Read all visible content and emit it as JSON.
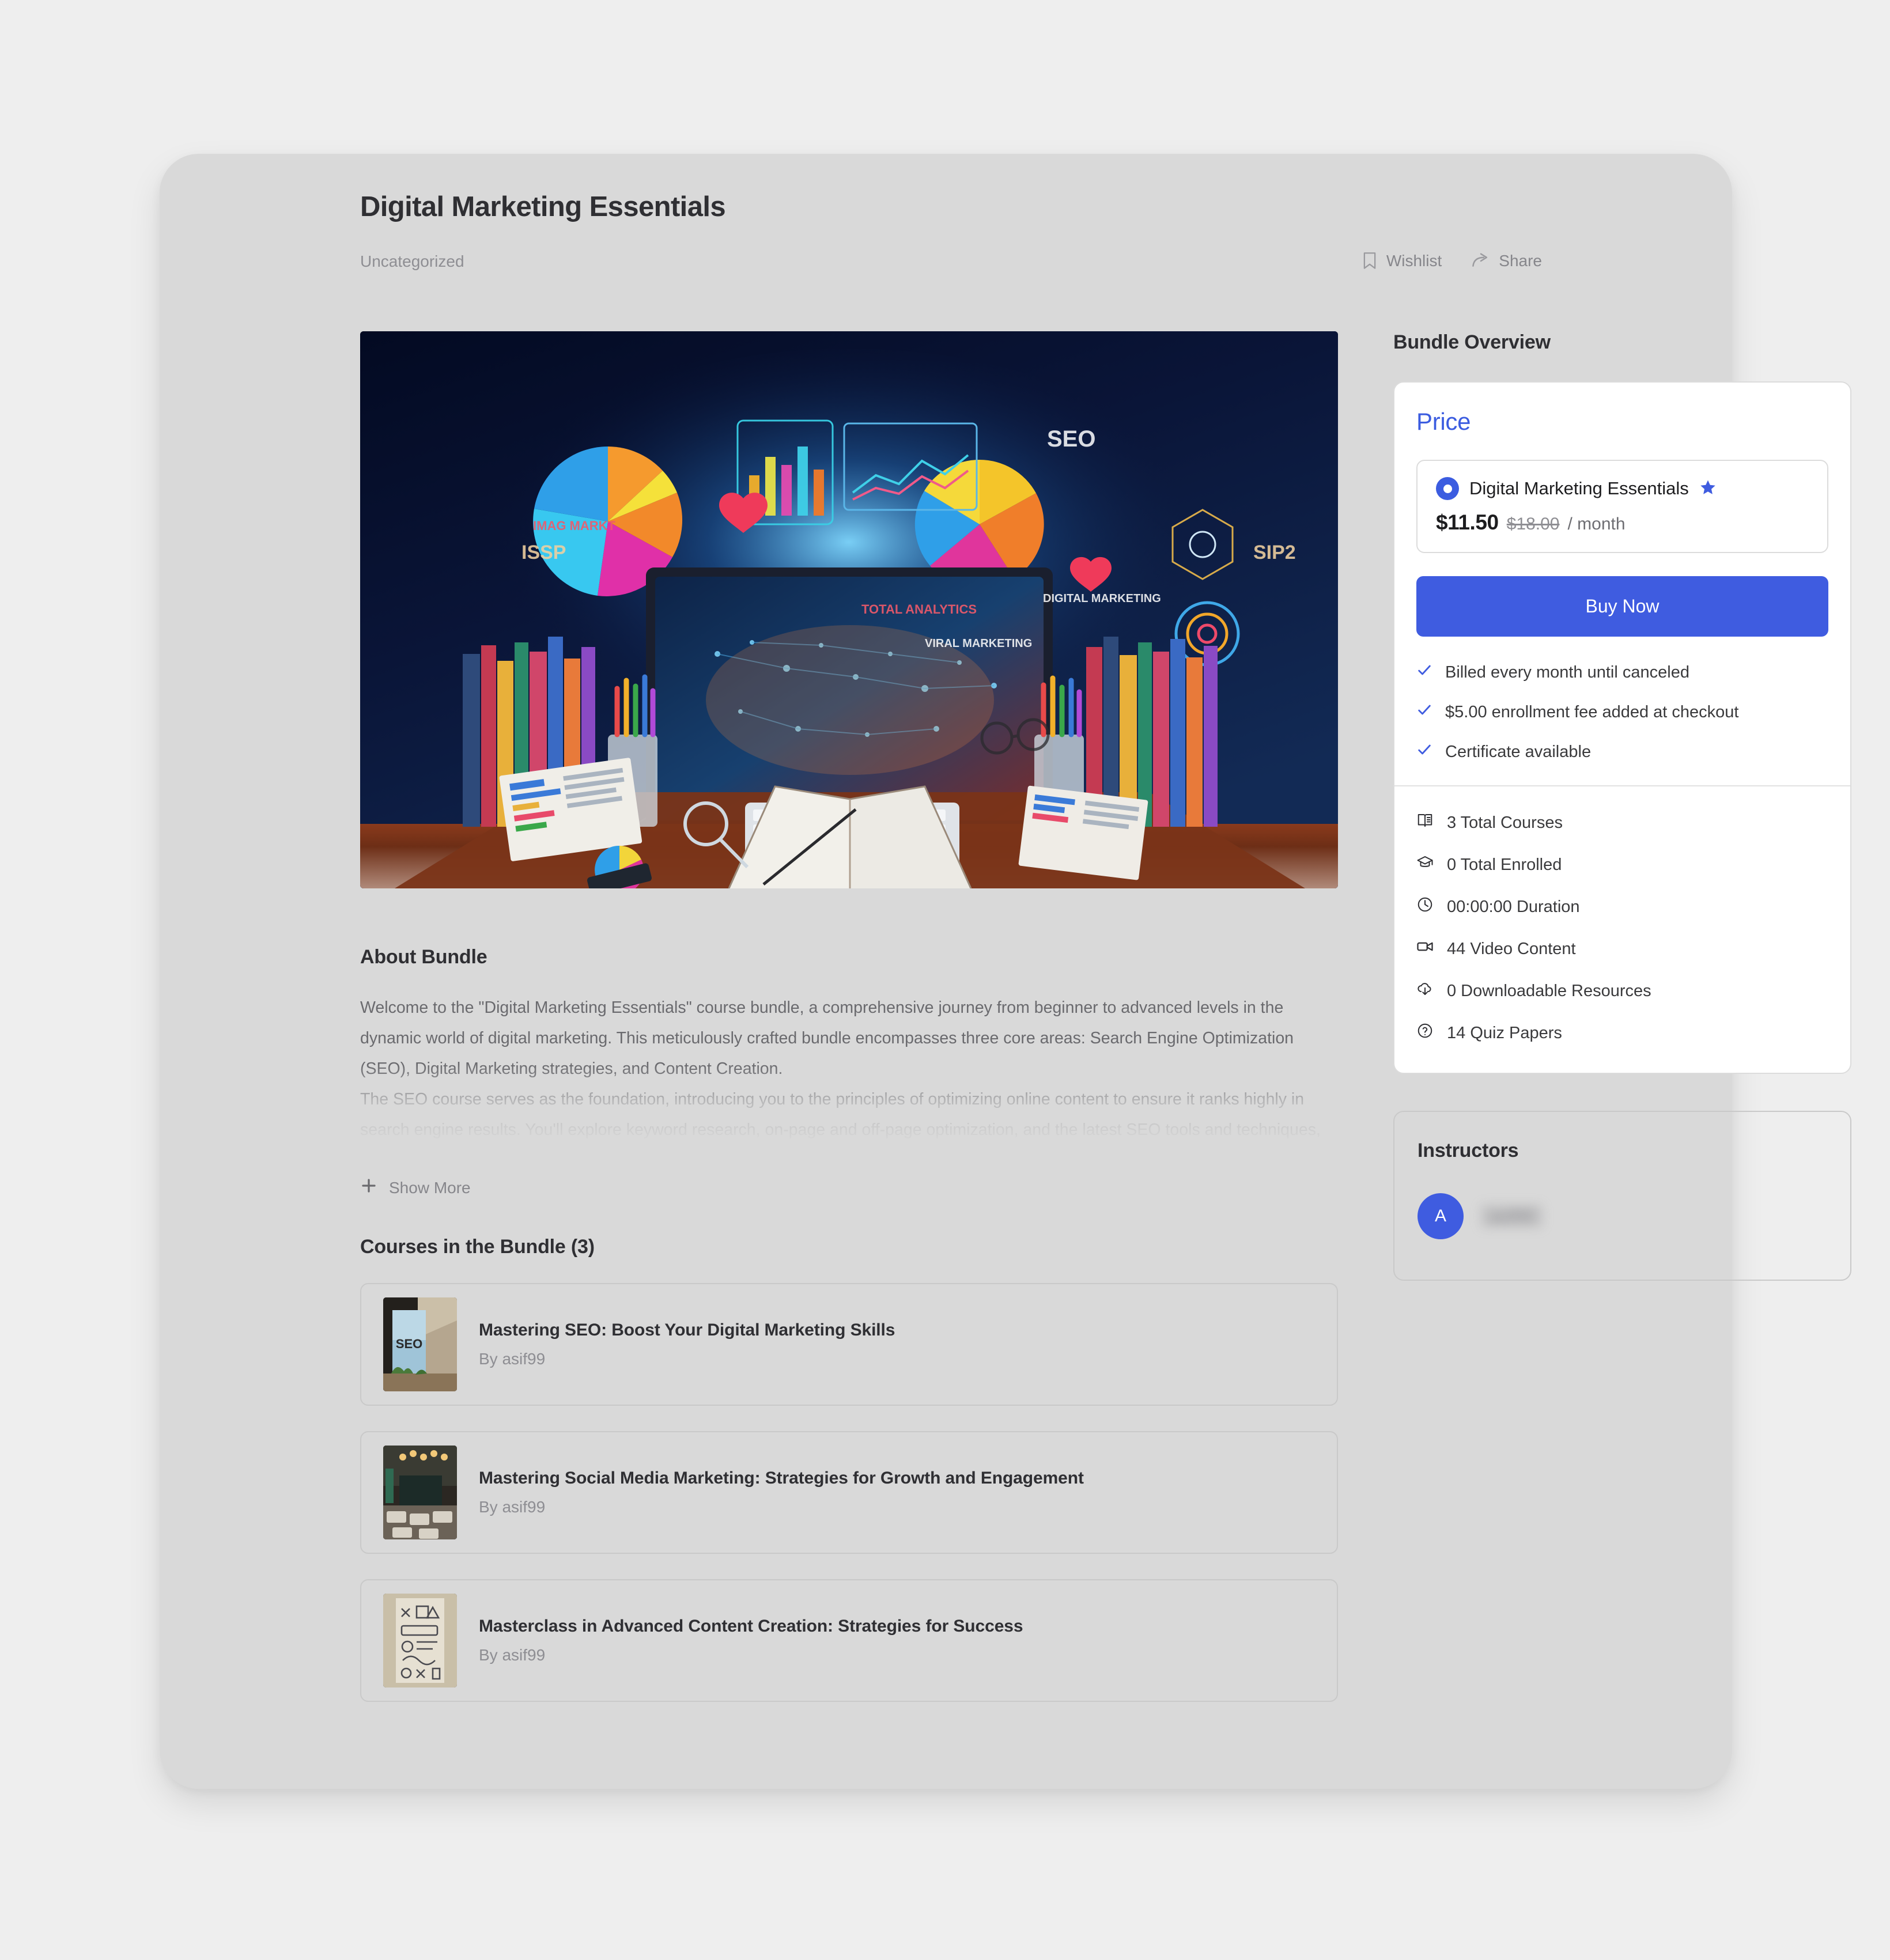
{
  "header": {
    "title": "Digital Marketing Essentials",
    "category": "Uncategorized",
    "actions": [
      {
        "label": "Wishlist",
        "icon": "bookmark-icon"
      },
      {
        "label": "Share",
        "icon": "share-icon"
      }
    ]
  },
  "about": {
    "heading": "About Bundle",
    "paragraph_1": "Welcome to the \"Digital Marketing Essentials\" course bundle, a comprehensive journey from beginner to advanced levels in the dynamic world of digital marketing. This meticulously crafted bundle encompasses three core areas: Search Engine Optimization (SEO), Digital Marketing strategies, and Content Creation.",
    "paragraph_2": "The SEO course serves as the foundation, introducing you to the principles of optimizing online content to ensure it ranks highly in search engine results. You'll explore keyword research, on-page and off-page optimization, and the latest SEO tools and techniques, empowering you to drive organic traffic effectively.",
    "show_more_label": "Show More"
  },
  "courses_section": {
    "heading": "Courses in the Bundle (3)",
    "items": [
      {
        "title": "Mastering SEO: Boost Your Digital Marketing Skills",
        "author": "By asif99",
        "thumb": "seo-book-thumbnail"
      },
      {
        "title": "Mastering Social Media Marketing: Strategies for Growth and Engagement",
        "author": "By asif99",
        "thumb": "social-media-classroom-thumbnail"
      },
      {
        "title": "Masterclass in Advanced Content Creation: Strategies for Success",
        "author": "By asif99",
        "thumb": "content-creation-sketch-thumbnail"
      }
    ]
  },
  "overview": {
    "heading": "Bundle Overview",
    "price_heading": "Price",
    "plan": {
      "name": "Digital Marketing Essentials",
      "badge_icon": "star-icon",
      "price_current": "$11.50",
      "price_original": "$18.00",
      "period": "/ month",
      "selected": true
    },
    "buy_button_label": "Buy Now",
    "benefits": [
      "Billed every month until canceled",
      "$5.00 enrollment fee added at checkout",
      "Certificate available"
    ],
    "stats": [
      {
        "icon": "book-icon",
        "label": "3 Total Courses"
      },
      {
        "icon": "graduation-cap-icon",
        "label": "0 Total Enrolled"
      },
      {
        "icon": "clock-icon",
        "label": "00:00:00 Duration"
      },
      {
        "icon": "video-camera-icon",
        "label": "44 Video Content"
      },
      {
        "icon": "cloud-download-icon",
        "label": "0 Downloadable Resources"
      },
      {
        "icon": "question-circle-icon",
        "label": "14 Quiz Papers"
      }
    ]
  },
  "instructors": {
    "heading": "Instructors",
    "items": [
      {
        "avatar_initial": "A",
        "name": "asif99"
      }
    ]
  },
  "colors": {
    "accent_blue": "#3f5ce0",
    "price_heading_blue": "#3b5ce0",
    "panel_bg": "#d9d9d9",
    "page_bg": "#eeeeee",
    "card_bg": "#ffffff",
    "text_primary": "#2f2f33",
    "text_muted": "#8e8e93"
  }
}
